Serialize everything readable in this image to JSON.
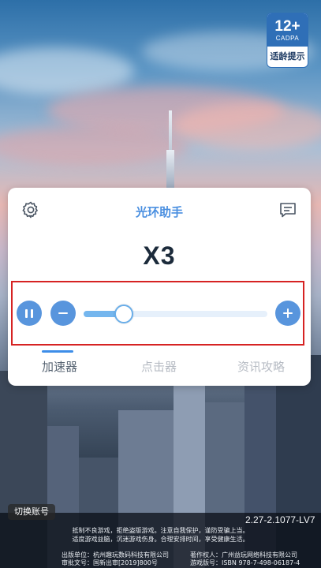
{
  "age_rating": {
    "number": "12+",
    "org": "CADPA",
    "label": "适龄提示"
  },
  "panel": {
    "title": "光环助手",
    "multiplier": "X3",
    "speed_fraction": 0.22,
    "tabs": [
      {
        "label": "加速器",
        "active": true
      },
      {
        "label": "点击器",
        "active": false
      },
      {
        "label": "资讯攻略",
        "active": false
      }
    ]
  },
  "icons": {
    "settings": "gear-icon",
    "message": "message-icon",
    "pause": "pause-icon",
    "minus": "minus-icon",
    "plus": "plus-icon"
  },
  "colors": {
    "accent": "#4a8fe0",
    "button": "#5895dd",
    "highlight": "#d62323"
  },
  "switch_account": "切换账号",
  "version": "2.27-2.1077-LV7",
  "notice": {
    "line1": "抵制不良游戏，拒绝盗版游戏。注意自我保护，谨防受骗上当。",
    "line2": "适度游戏益脑，沉迷游戏伤身。合理安排时间，享受健康生活。"
  },
  "footer": {
    "publisher": "出版单位：杭州趣玩数码科技有限公司",
    "approval": "审批文号：国新出审[2019]800号",
    "copyright": "著作权人：广州益玩网络科技有限公司",
    "isbn": "游戏版号：ISBN 978-7-498-06187-4"
  }
}
